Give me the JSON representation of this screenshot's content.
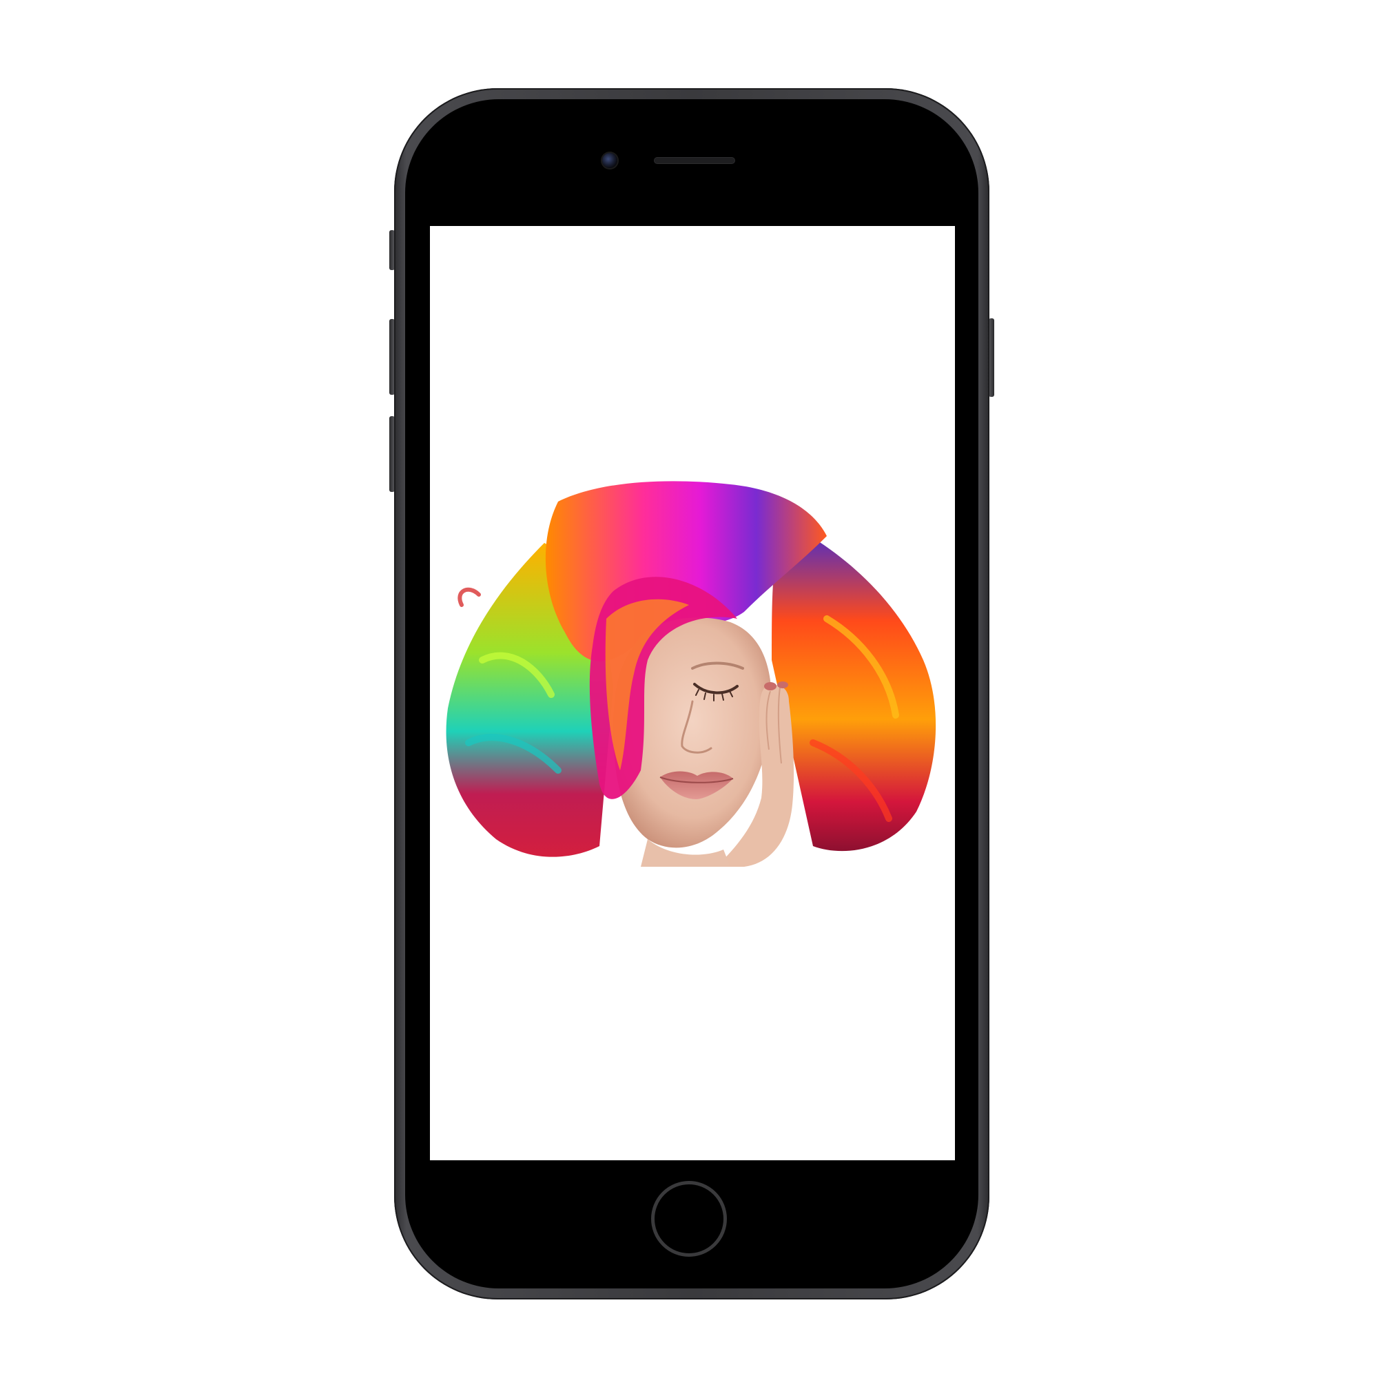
{
  "device": {
    "type": "smartphone",
    "color": "#3a3a3d"
  },
  "screen": {
    "background": "#ffffff",
    "content": {
      "image": "portrait-rainbow-hair-illustration"
    }
  },
  "icons": {
    "camera": "front-camera-icon",
    "speaker": "earpiece-speaker",
    "home": "home-button"
  }
}
